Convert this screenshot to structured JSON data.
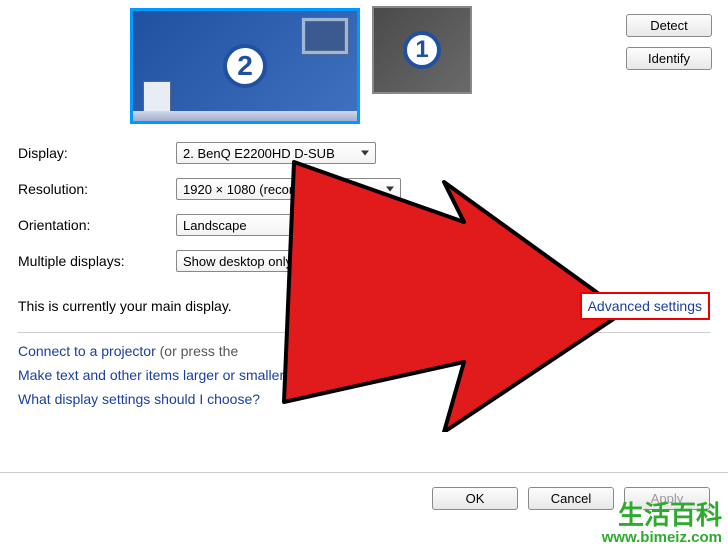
{
  "monitors": {
    "primary_label": "2",
    "secondary_label": "1"
  },
  "buttons": {
    "detect": "Detect",
    "identify": "Identify",
    "ok": "OK",
    "cancel": "Cancel",
    "apply": "Apply"
  },
  "labels": {
    "display": "Display:",
    "resolution": "Resolution:",
    "orientation": "Orientation:",
    "multiple_displays": "Multiple displays:",
    "main_display_note": "This is currently your main display.",
    "advanced_settings": "Advanced settings"
  },
  "values": {
    "display": "2. BenQ E2200HD D-SUB",
    "resolution": "1920 × 1080 (recommended)",
    "orientation": "Landscape",
    "multiple_displays": "Show desktop only on 2"
  },
  "links": {
    "projector_prefix": "Connect to a projector",
    "projector_suffix": " (or press the",
    "ease_of_access": "Make text and other items larger or smaller",
    "help": "What display settings should I choose?"
  },
  "watermark": {
    "cn": "生活百科",
    "url": "www.bimeiz.com"
  }
}
